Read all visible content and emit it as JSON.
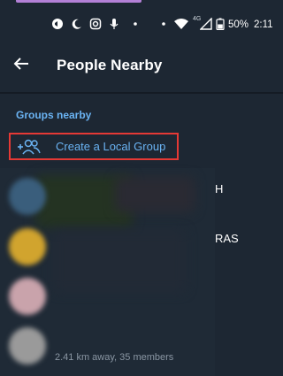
{
  "status_bar": {
    "network_label": "4G",
    "battery": "50%",
    "time": "2:11"
  },
  "header": {
    "title": "People Nearby"
  },
  "section": {
    "groups_header": "Groups nearby"
  },
  "create_group": {
    "label": "Create a Local Group"
  },
  "groups": [
    {
      "name_fragment": "H"
    },
    {
      "name_fragment": "RAS"
    }
  ],
  "last_group": {
    "subtitle": "2.41 km away, 35 members"
  },
  "colors": {
    "background": "#1d2733",
    "accent_blue": "#6ab3f3",
    "highlight_red": "#e53935"
  }
}
